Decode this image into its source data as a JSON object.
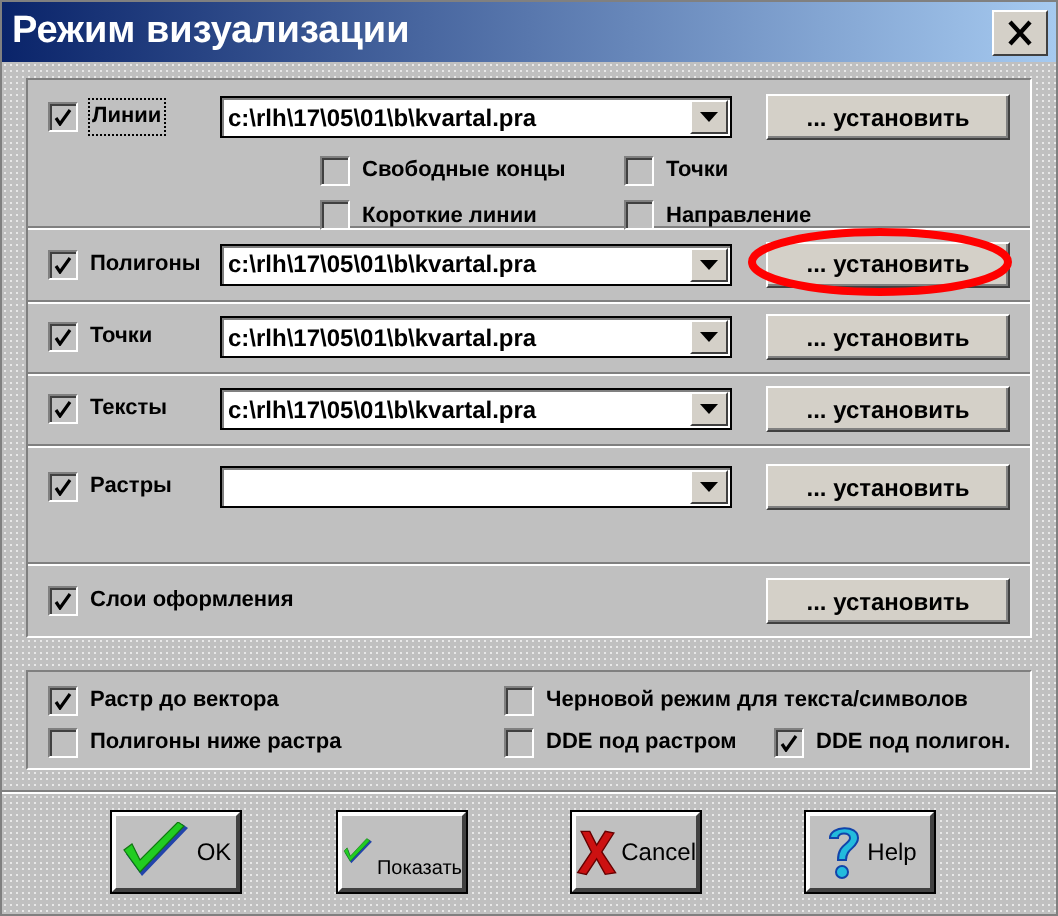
{
  "window": {
    "title": "Режим визуализации"
  },
  "layers": [
    {
      "label": "Линии",
      "checked": true,
      "focused": true,
      "path": "c:\\rlh\\17\\05\\01\\b\\kvartal.pra",
      "button": "... установить",
      "circled": false,
      "options": [
        {
          "label": "Свободные концы",
          "checked": false
        },
        {
          "label": "Точки",
          "checked": false
        },
        {
          "label": "Короткие линии",
          "checked": false
        },
        {
          "label": "Направление",
          "checked": false
        }
      ]
    },
    {
      "label": "Полигоны",
      "checked": true,
      "focused": false,
      "path": "c:\\rlh\\17\\05\\01\\b\\kvartal.pra",
      "button": "... установить",
      "circled": true
    },
    {
      "label": "Точки",
      "checked": true,
      "focused": false,
      "path": "c:\\rlh\\17\\05\\01\\b\\kvartal.pra",
      "button": "... установить",
      "circled": false
    },
    {
      "label": "Тексты",
      "checked": true,
      "focused": false,
      "path": "c:\\rlh\\17\\05\\01\\b\\kvartal.pra",
      "button": "... установить",
      "circled": false
    },
    {
      "label": "Растры",
      "checked": true,
      "focused": false,
      "button": "... установить",
      "circled": false
    }
  ],
  "design_layers": {
    "label": "Слои оформления",
    "checked": true,
    "button": "... установить"
  },
  "options": [
    [
      {
        "label": "Растр до вектора",
        "checked": true
      },
      {
        "label": "Черновой режим для текста/символов",
        "checked": false
      }
    ],
    [
      {
        "label": "Полигоны ниже растра",
        "checked": false
      },
      {
        "label": "DDE под растром",
        "checked": false
      },
      {
        "label": "DDE под полигон.",
        "checked": true
      }
    ]
  ],
  "buttons": [
    {
      "label": "OK",
      "kind": "check"
    },
    {
      "label": "Показать",
      "kind": "check-small"
    },
    {
      "label": "Cancel",
      "kind": "cross"
    },
    {
      "label": "Help",
      "kind": "question"
    }
  ]
}
